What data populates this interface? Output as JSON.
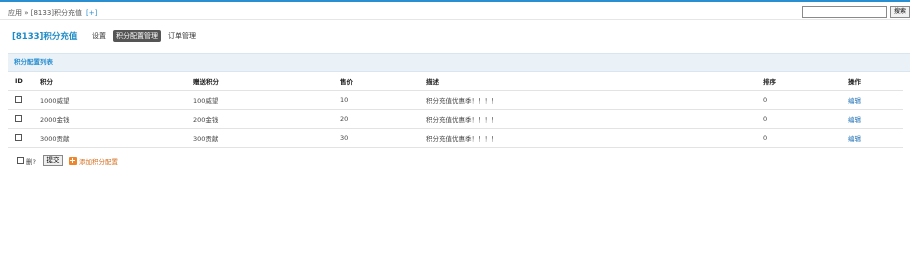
{
  "breadcrumb": {
    "text": "应用 » [8133]积分充值",
    "add": "[+]"
  },
  "search": {
    "button_label": "搜索",
    "value": ""
  },
  "page_title": "[8133]积分充值",
  "nav": [
    {
      "label": "设置"
    },
    {
      "label": "积分配置管理"
    },
    {
      "label": "订单管理"
    }
  ],
  "panel": {
    "title": "积分配置列表"
  },
  "table": {
    "headers": {
      "id": "ID",
      "score": "积分",
      "gift": "赠送积分",
      "price": "售价",
      "desc": "描述",
      "sort": "排序",
      "op": "操作"
    },
    "rows": [
      {
        "score": "1000威望",
        "gift": "100威望",
        "price": "10",
        "desc": "积分充值优惠季！！！！",
        "sort": "0",
        "op": "编辑"
      },
      {
        "score": "2000金钱",
        "gift": "200金钱",
        "price": "20",
        "desc": "积分充值优惠季！！！！",
        "sort": "0",
        "op": "编辑"
      },
      {
        "score": "3000贡献",
        "gift": "300贡献",
        "price": "30",
        "desc": "积分充值优惠季！！！！",
        "sort": "0",
        "op": "编辑"
      }
    ]
  },
  "footer": {
    "delete_label": "删?",
    "submit_label": "提交",
    "add_label": "添加积分配置"
  },
  "colors": {
    "accent": "#2a8fd0",
    "title": "#1c8bc6",
    "link": "#1c6fb5",
    "add": "#f0852c"
  }
}
